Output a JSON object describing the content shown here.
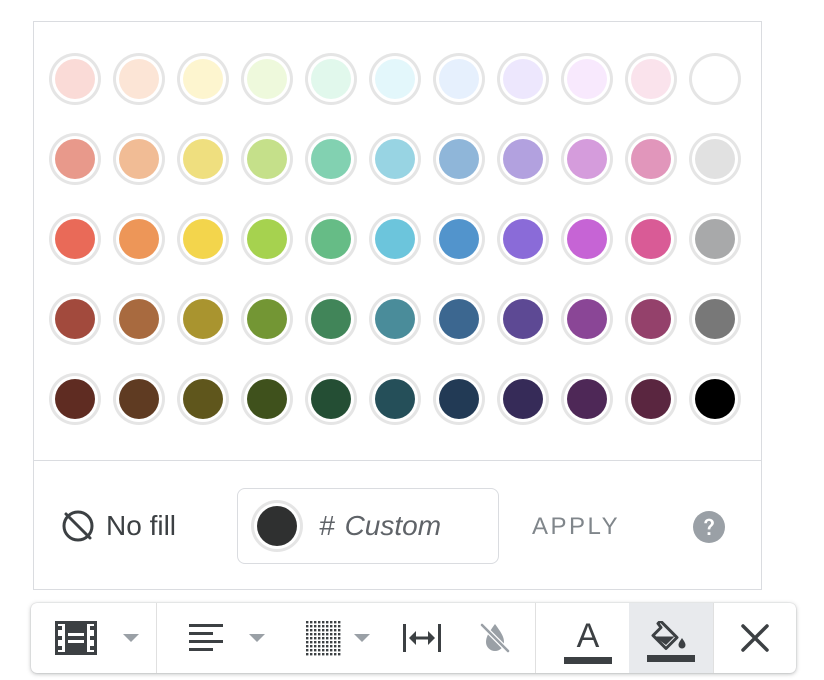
{
  "palette": {
    "rows": [
      [
        "#fadbd7",
        "#fce5d6",
        "#fdf5cf",
        "#eef9dc",
        "#e1f8ec",
        "#e3f7fb",
        "#e6f0fd",
        "#ede7fd",
        "#f8e9fd",
        "#fae3ec",
        "#ffffff"
      ],
      [
        "#e8998b",
        "#f1bc95",
        "#efdf7f",
        "#c5e08a",
        "#82d1b1",
        "#98d4e3",
        "#8fb6d9",
        "#b2a1df",
        "#d59cdc",
        "#e196bb",
        "#e1e1e1"
      ],
      [
        "#e96a58",
        "#ed9658",
        "#f3d54c",
        "#a6d24f",
        "#66bc86",
        "#6cc5dc",
        "#5294cc",
        "#8a6bd8",
        "#c664d5",
        "#d95b96",
        "#a8a9aa"
      ],
      [
        "#a24a3d",
        "#a86a3f",
        "#a9942f",
        "#739634",
        "#418559",
        "#4a8c9a",
        "#3c6790",
        "#5d4994",
        "#8a4696",
        "#94416b",
        "#787878"
      ],
      [
        "#5f2c22",
        "#5f3b22",
        "#5f561c",
        "#3f511c",
        "#244e34",
        "#254f59",
        "#223a55",
        "#362b58",
        "#4e2857",
        "#5a2640",
        "#000000"
      ]
    ]
  },
  "no_fill": {
    "label": "No fill",
    "icon": "no-fill-icon"
  },
  "custom": {
    "hash": "#",
    "placeholder": "Custom",
    "value": "",
    "swatch_color": "#2f3030"
  },
  "apply_label": "APPLY",
  "help_icon": "help-icon",
  "toolbar": {
    "buttons": [
      {
        "name": "border-style-icon",
        "has_dropdown": true
      },
      {
        "name": "align-left-icon",
        "has_dropdown": true
      },
      {
        "name": "border-dotted-grid-icon",
        "has_dropdown": true
      },
      {
        "name": "column-width-icon",
        "has_dropdown": false
      },
      {
        "name": "no-color-drop-icon",
        "has_dropdown": false,
        "disabled": true
      },
      {
        "name": "text-color-icon",
        "letter": "A"
      },
      {
        "name": "fill-color-icon",
        "active": true
      },
      {
        "name": "close-icon"
      }
    ]
  },
  "colors": {
    "icon": "#3c4043",
    "muted": "#9aa0a6",
    "border": "#dadce0",
    "active_bg": "#e8eaed"
  }
}
